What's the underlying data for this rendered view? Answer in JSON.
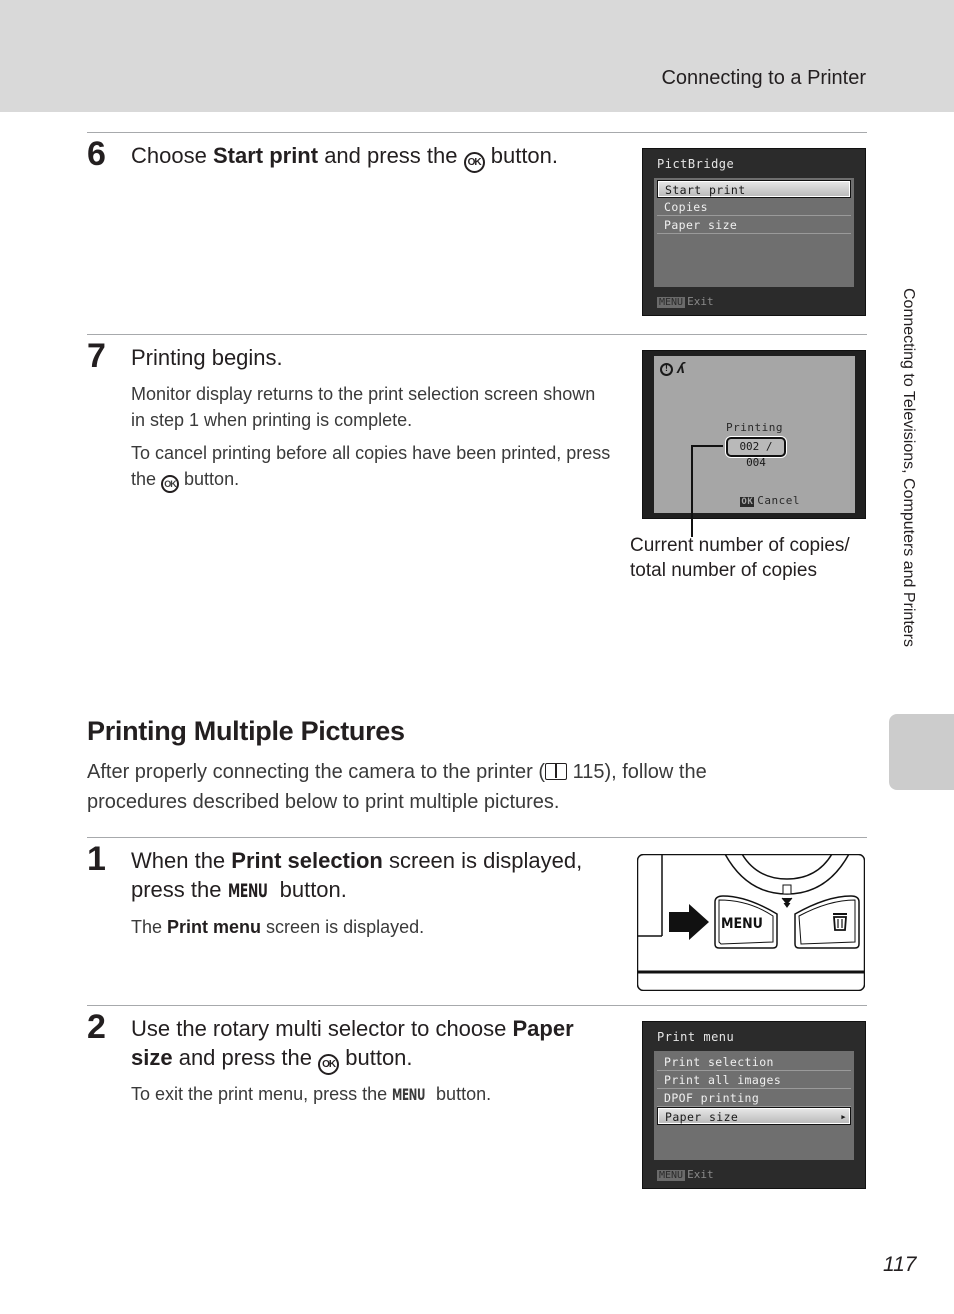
{
  "header": {
    "title": "Connecting to a Printer"
  },
  "side_tab": {
    "label": "Connecting to Televisions, Computers and Printers"
  },
  "steps_top": [
    {
      "number": "6",
      "heading_pre": "Choose ",
      "heading_bold": "Start print",
      "heading_mid": " and press the ",
      "heading_icon": "OK",
      "heading_post": " button.",
      "screen": {
        "title": "PictBridge",
        "items": [
          "Start print",
          "Copies",
          "Paper size"
        ],
        "selected_index": 0,
        "footer_icon": "MENU",
        "footer_label": "Exit"
      }
    },
    {
      "number": "7",
      "heading": "Printing begins.",
      "para1": "Monitor display returns to the print selection screen shown in step 1 when printing is complete.",
      "para2_pre": "To cancel printing before all copies have been printed, press the ",
      "para2_icon": "OK",
      "para2_post": " button.",
      "screen": {
        "status_label": "Printing",
        "counter": "002 / 004",
        "current_copy": 2,
        "total_copies": 4,
        "cancel_icon": "OK",
        "cancel_label": "Cancel"
      },
      "callout": {
        "line1": "Current number of copies/",
        "line2": "total number of copies"
      }
    }
  ],
  "section": {
    "title": "Printing Multiple Pictures",
    "intro_pre": "After properly connecting the camera to the printer (",
    "intro_ref": "115",
    "intro_post": "), follow the procedures described below to print multiple pictures."
  },
  "steps_bottom": [
    {
      "number": "1",
      "heading_pre": "When the ",
      "heading_bold": "Print selection",
      "heading_mid": " screen is displayed, press the ",
      "heading_icon": "MENU",
      "heading_post": " button.",
      "body_pre": "The ",
      "body_bold": "Print menu",
      "body_post": " screen is displayed.",
      "illustration": {
        "button_label": "MENU",
        "right_button_icon": "trash-icon"
      }
    },
    {
      "number": "2",
      "heading_pre": "Use the rotary multi selector to choose ",
      "heading_bold1": "Paper",
      "heading_bold2": "size",
      "heading_mid": " and press the ",
      "heading_icon": "OK",
      "heading_post": " button.",
      "body_pre": "To exit the print menu, press the ",
      "body_icon": "MENU",
      "body_post": " button.",
      "screen": {
        "title": "Print menu",
        "items": [
          "Print selection",
          "Print all images",
          "DPOF printing",
          "Paper size"
        ],
        "selected_index": 3,
        "footer_icon": "MENU",
        "footer_label": "Exit"
      }
    }
  ],
  "page_number": "117"
}
